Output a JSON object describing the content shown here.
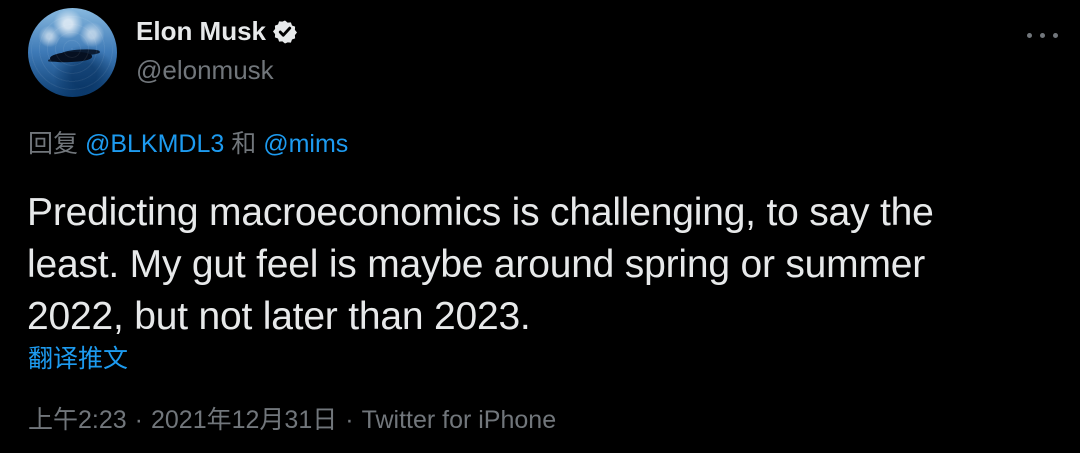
{
  "profile": {
    "display_name": "Elon Musk",
    "handle": "@elonmusk",
    "avatar_icon": "avatar-photo-icon",
    "verified_icon": "verified-badge-icon"
  },
  "menu": {
    "icon": "more-options-icon"
  },
  "reply": {
    "prefix": "回复",
    "mention_1": "@BLKMDL3",
    "connector": "和",
    "mention_2": "@mims"
  },
  "tweet": {
    "line_1": "Predicting macroeconomics is challenging, to say the",
    "line_2": "least. My gut feel is maybe around spring or summer",
    "line_3": "2022, but not later than 2023.",
    "translate_label": "翻译推文"
  },
  "meta": {
    "time": "上午2:23",
    "separator": "·",
    "date": "2021年12月31日",
    "source": "Twitter for iPhone"
  },
  "colors": {
    "background": "#000000",
    "text": "#e7e9ea",
    "secondary": "#71767b",
    "accent": "#1d9bf0"
  }
}
